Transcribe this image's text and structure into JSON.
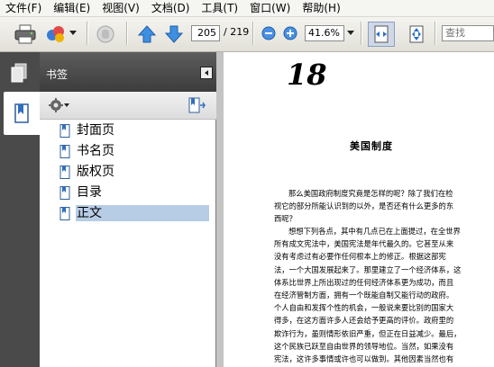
{
  "menu": [
    "文件(F)",
    "编辑(E)",
    "视图(V)",
    "文档(D)",
    "工具(T)",
    "窗口(W)",
    "帮助(H)"
  ],
  "toolbar": {
    "page_current": "205",
    "page_total": "/ 219",
    "zoom": "41.6%",
    "search_placeholder": "查找"
  },
  "panel": {
    "title": "书签",
    "bookmarks": [
      "封面页",
      "书名页",
      "版权页",
      "目录",
      "正文"
    ],
    "selected_index": 4
  },
  "document": {
    "chapter_number": "18",
    "section_title": "美国制度",
    "paragraphs": [
      [
        "那么美国政府制度究竟是怎样的呢？除了我们在检",
        "视它的部分所能认识到的以外，是否还有什么更多的东",
        "西呢？"
      ],
      [
        "想想下列各点，其中有几点已在上面提过，在全世界",
        "所有成文宪法中，美国宪法是年代最久的。它甚至从来",
        "没有考虑过有必要作任何根本上的修正。根据这部宪",
        "法，一个大国发展起来了。那里建立了一个经济体系，这",
        "体系比世界上所出现过的任何经济体系更为成功，而且",
        "在经济管制方面，拥有一个既能自制又能行动的政府。",
        "个人自由和发挥个性的机会，一般说来要比别的国家大",
        "得多，在这方面许多人还会给予更高的评价。政府里的",
        "欺诈行为，虽则情形依旧严重，但正在日益减少。最后，",
        "这个民族已跃至自由世界的领导地位。当然，如果没有",
        "宪法，这许多事情或许也可以做到。其他因素当然也有"
      ]
    ]
  }
}
